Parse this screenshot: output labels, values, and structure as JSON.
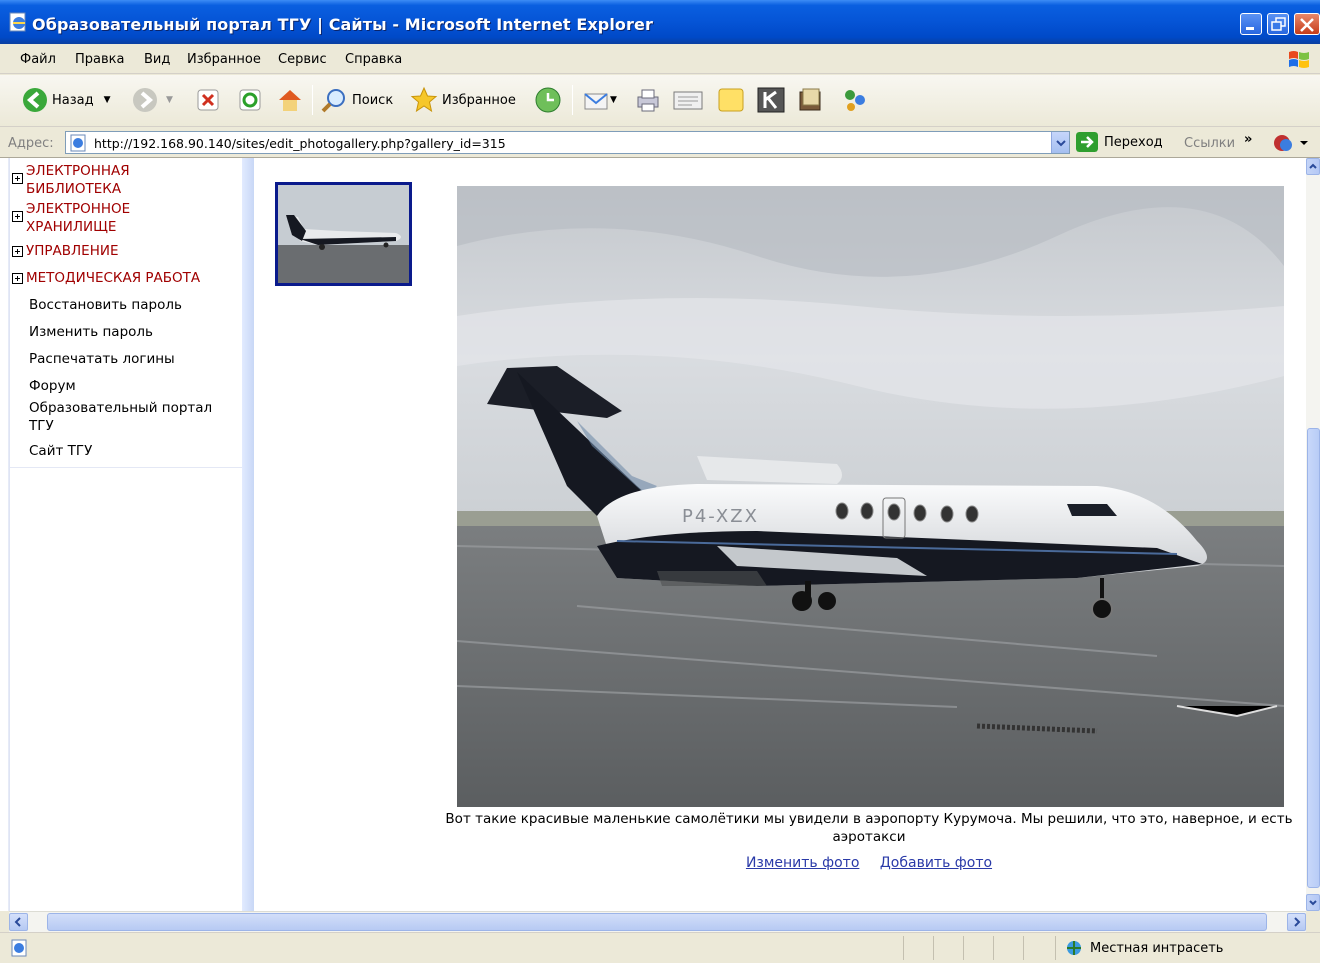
{
  "window": {
    "title": "Образовательный портал ТГУ | Сайты - Microsoft Internet Explorer"
  },
  "menu": [
    "Файл",
    "Правка",
    "Вид",
    "Избранное",
    "Сервис",
    "Справка"
  ],
  "toolbar": {
    "back_label": "Назад",
    "search_label": "Поиск",
    "favorites_label": "Избранное"
  },
  "address": {
    "label": "Адрес:",
    "url": "http://192.168.90.140/sites/edit_photogallery.php?gallery_id=315",
    "go_label": "Переход",
    "links_label": "Ссылки",
    "chevron": "»"
  },
  "sidebar": {
    "sections": [
      {
        "label": "ЭЛЕКТРОННАЯ БИБЛИОТЕКА"
      },
      {
        "label": "ЭЛЕКТРОННОЕ ХРАНИЛИЩЕ"
      },
      {
        "label": "УПРАВЛЕНИЕ"
      },
      {
        "label": "МЕТОДИЧЕСКАЯ РАБОТА"
      }
    ],
    "links": [
      {
        "label": "Восстановить пароль"
      },
      {
        "label": "Изменить пароль"
      },
      {
        "label": "Распечатать логины"
      },
      {
        "label": "Форум"
      },
      {
        "label": "Образовательный портал ТГУ"
      },
      {
        "label": "Сайт ТГУ"
      }
    ]
  },
  "photo": {
    "caption": "Вот такие красивые маленькие самолётики мы увидели в аэропорту Курумоча. Мы решили, что это, наверное, и есть аэротакси",
    "tail_registration": "P4-XZX",
    "edit_label": "Изменить фото",
    "add_label": "Добавить фото"
  },
  "status": {
    "zone": "Местная интрасеть"
  },
  "colors": {
    "nav_section": "#a00000",
    "link": "#2a3aa8",
    "thumb_border": "#0a1a8c"
  }
}
